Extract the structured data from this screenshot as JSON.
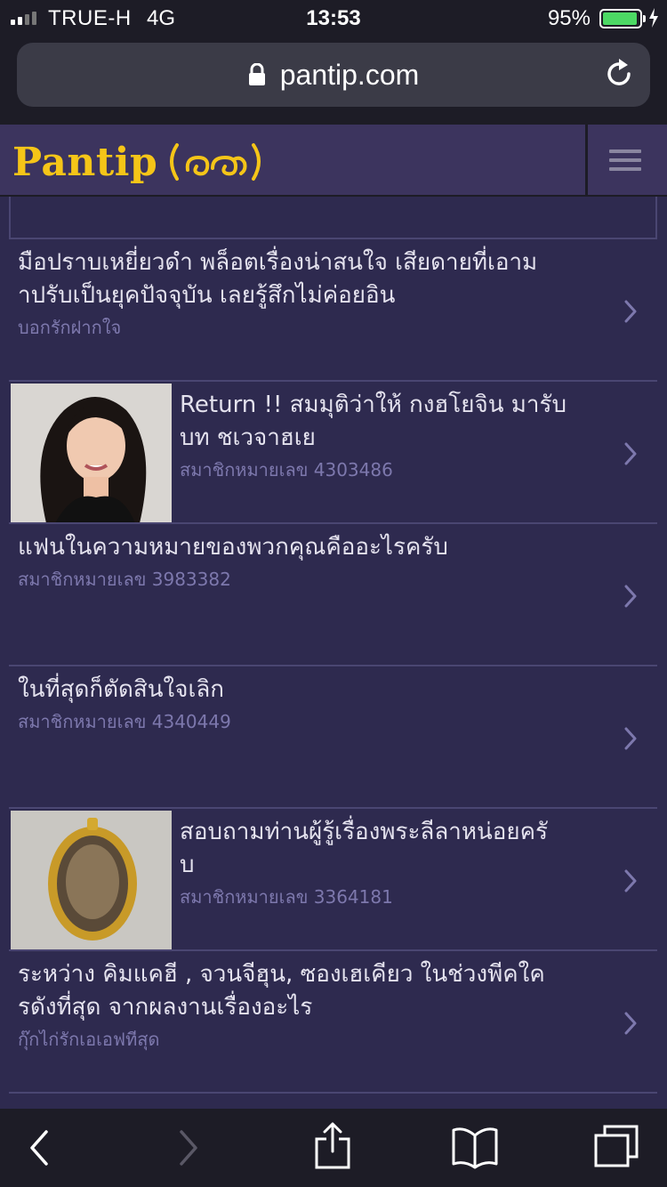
{
  "status_bar": {
    "carrier": "TRUE-H",
    "network": "4G",
    "time": "13:53",
    "battery_percent": "95%",
    "battery_level": 0.95
  },
  "browser": {
    "url": "pantip.com"
  },
  "site": {
    "logo_text": "Pantip"
  },
  "topics": [
    {
      "title": "มือปราบเหยี่ยวดำ พล็อตเรื่องน่าสนใจ เสียดายที่เอามาปรับเป็นยุคปัจจุบัน เลยรู้สึกไม่ค่อยอิน",
      "title_lines": [
        "มือปราบเหยี่ยวดำ พล็อตเรื่องน่าสนใจ เสียดายที่เอาม",
        "าปรับเป็นยุคปัจจุบัน เลยรู้สึกไม่ค่อยอิน"
      ],
      "author": "บอกรักฝากใจ",
      "thumbnail": null
    },
    {
      "title": "Return !! สมมุติว่าให้ กงฮโยจิน มารับบท ชเวจาฮเย",
      "title_lines": [
        "Return !! สมมุติว่าให้ กงฮโยจิน มารับ",
        "บท ชเวจาฮเย"
      ],
      "author": "สมาชิกหมายเลข 4303486",
      "thumbnail": "portrait-photo"
    },
    {
      "title": "แฟนในความหมายของพวกคุณคืออะไรครับ",
      "title_lines": [
        "แฟนในความหมายของพวกคุณคืออะไรครับ"
      ],
      "author": "สมาชิกหมายเลข 3983382",
      "thumbnail": null
    },
    {
      "title": "ในที่สุดก็ตัดสินใจเลิก",
      "title_lines": [
        "ในที่สุดก็ตัดสินใจเลิก"
      ],
      "author": "สมาชิกหมายเลข 4340449",
      "thumbnail": null
    },
    {
      "title": "สอบถามท่านผู้รู้เรื่องพระลีลาหน่อยครับ",
      "title_lines": [
        "สอบถามท่านผู้รู้เรื่องพระลีลาหน่อยครั",
        "บ"
      ],
      "author": "สมาชิกหมายเลข 3364181",
      "thumbnail": "amulet-photo"
    },
    {
      "title": "ระหว่าง คิมแคฮี , จวนจีฮุน, ซองเฮเคียว ในช่วงพีคใครดังที่สุด จากผลงานเรื่องอะไร",
      "title_lines": [
        "ระหว่าง คิมแคฮี , จวนจีฮุน, ซองเฮเคียว ในช่วงพีคใค",
        "รดังที่สุด จากผลงานเรื่องอะไร"
      ],
      "author": "กุ๊กไก่รักเอเอฟทีสุด",
      "thumbnail": null
    }
  ],
  "colors": {
    "page_bg": "#2e2a4f",
    "header_bg": "#3c345e",
    "logo": "#f5c518",
    "title_text": "#e4e2ee",
    "author_text": "#7d78ad",
    "divider": "#4a4672",
    "browser_chrome": "#1d1c26"
  },
  "icons": {
    "back": "chevron-left-icon",
    "forward": "chevron-right-icon",
    "share": "share-icon",
    "bookmarks": "book-icon",
    "tabs": "tabs-icon",
    "reload": "reload-icon",
    "lock": "lock-icon",
    "menu": "hamburger-icon"
  }
}
